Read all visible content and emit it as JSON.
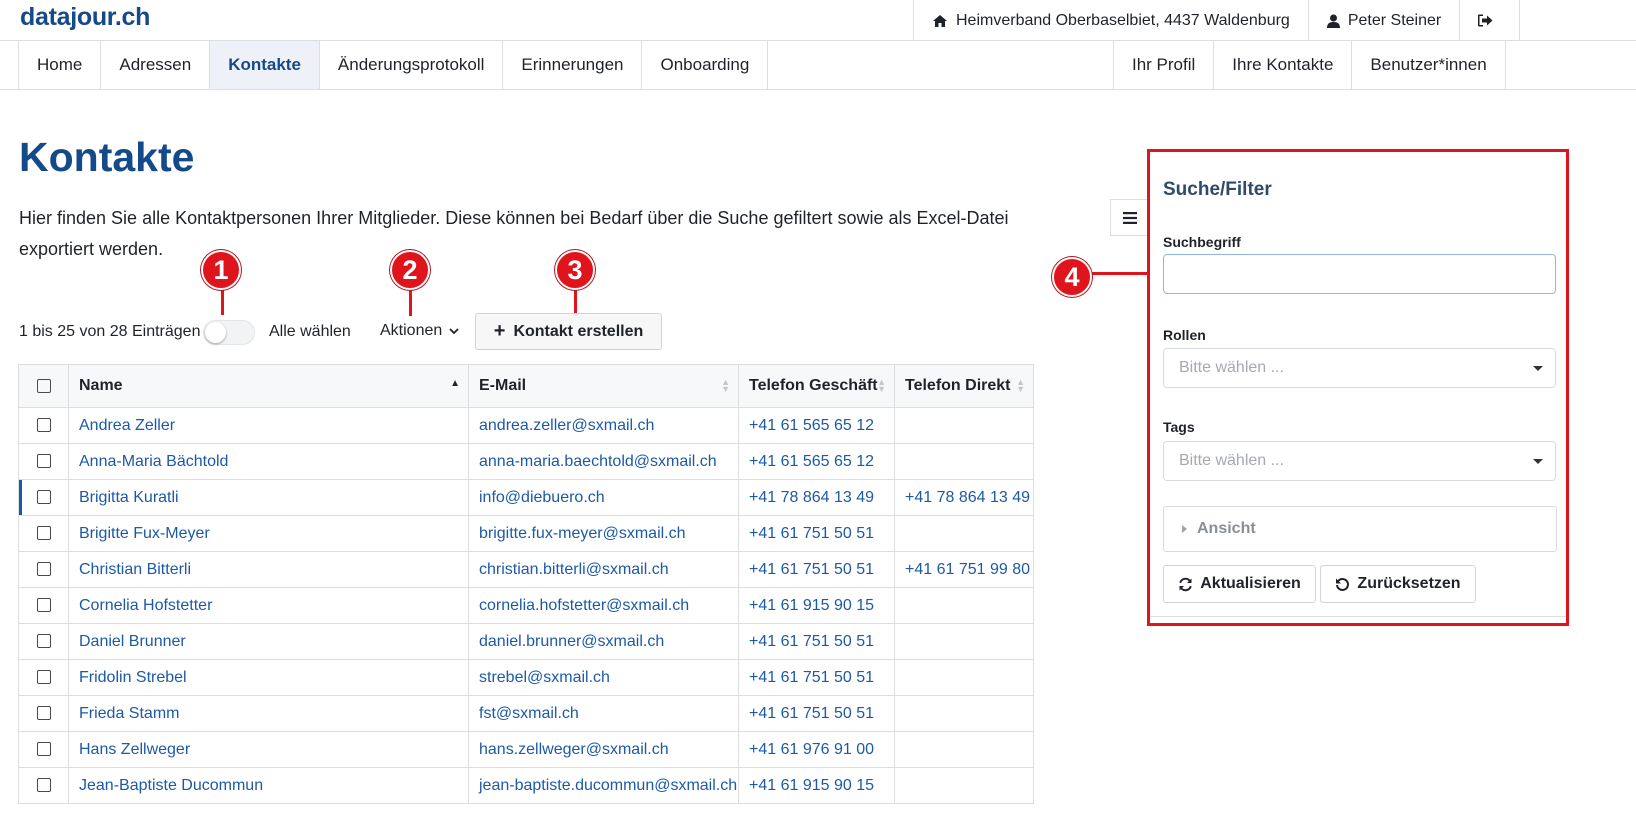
{
  "header": {
    "logo": "datajour.ch",
    "organization": "Heimverband Oberbaselbiet, 4437 Waldenburg",
    "user": "Peter Steiner",
    "icons": [
      "home-icon",
      "user-icon",
      "logout-icon"
    ]
  },
  "nav": {
    "left": [
      "Home",
      "Adressen",
      "Kontakte",
      "Änderungsprotokoll",
      "Erinnerungen",
      "Onboarding"
    ],
    "right": [
      "Ihr Profil",
      "Ihre Kontakte",
      "Benutzer*innen"
    ],
    "active": "Kontakte"
  },
  "page": {
    "title": "Kontakte",
    "intro": "Hier finden Sie alle Kontaktpersonen Ihrer Mitglieder. Diese können bei Bedarf über die Suche gefiltert sowie als Excel-Datei exportiert werden."
  },
  "toolbar": {
    "entries": "1 bis 25 von 28 Einträgen",
    "select_all": "Alle wählen",
    "actions": "Aktionen",
    "create": "Kontakt erstellen"
  },
  "markers": [
    "1",
    "2",
    "3",
    "4"
  ],
  "table": {
    "columns": [
      "Name",
      "E-Mail",
      "Telefon Geschäft",
      "Telefon Direkt"
    ],
    "rows": [
      {
        "name": "Andrea Zeller",
        "email": "andrea.zeller@sxmail.ch",
        "phone_business": "+41 61 565 65 12",
        "phone_direct": ""
      },
      {
        "name": "Anna-Maria Bächtold",
        "email": "anna-maria.baechtold@sxmail.ch",
        "phone_business": "+41 61 565 65 12",
        "phone_direct": ""
      },
      {
        "name": "Brigitta Kuratli",
        "email": "info@diebuero.ch",
        "phone_business": "+41 78 864 13 49",
        "phone_direct": "+41 78 864 13 49"
      },
      {
        "name": "Brigitte Fux-Meyer",
        "email": "brigitte.fux-meyer@sxmail.ch",
        "phone_business": "+41 61 751 50 51",
        "phone_direct": ""
      },
      {
        "name": "Christian Bitterli",
        "email": "christian.bitterli@sxmail.ch",
        "phone_business": "+41 61 751 50 51",
        "phone_direct": "+41 61 751 99 80"
      },
      {
        "name": "Cornelia Hofstetter",
        "email": "cornelia.hofstetter@sxmail.ch",
        "phone_business": "+41 61 915 90 15",
        "phone_direct": ""
      },
      {
        "name": "Daniel Brunner",
        "email": "daniel.brunner@sxmail.ch",
        "phone_business": "+41 61 751 50 51",
        "phone_direct": ""
      },
      {
        "name": "Fridolin Strebel",
        "email": "strebel@sxmail.ch",
        "phone_business": "+41 61 751 50 51",
        "phone_direct": ""
      },
      {
        "name": "Frieda Stamm",
        "email": "fst@sxmail.ch",
        "phone_business": "+41 61 751 50 51",
        "phone_direct": ""
      },
      {
        "name": "Hans Zellweger",
        "email": "hans.zellweger@sxmail.ch",
        "phone_business": "+41 61 976 91 00",
        "phone_direct": ""
      },
      {
        "name": "Jean-Baptiste Ducommun",
        "email": "jean-baptiste.ducommun@sxmail.ch",
        "phone_business": "+41 61 915 90 15",
        "phone_direct": ""
      }
    ]
  },
  "filter": {
    "title": "Suche/Filter",
    "search_label": "Suchbegriff",
    "search_value": "",
    "roles_label": "Rollen",
    "roles_placeholder": "Bitte wählen ...",
    "tags_label": "Tags",
    "tags_placeholder": "Bitte wählen ...",
    "view_label": "Ansicht",
    "refresh": "Aktualisieren",
    "reset": "Zurücksetzen"
  },
  "colors": {
    "brand": "#154a8a",
    "link": "#1d5aa6",
    "marker": "#e0141c"
  }
}
